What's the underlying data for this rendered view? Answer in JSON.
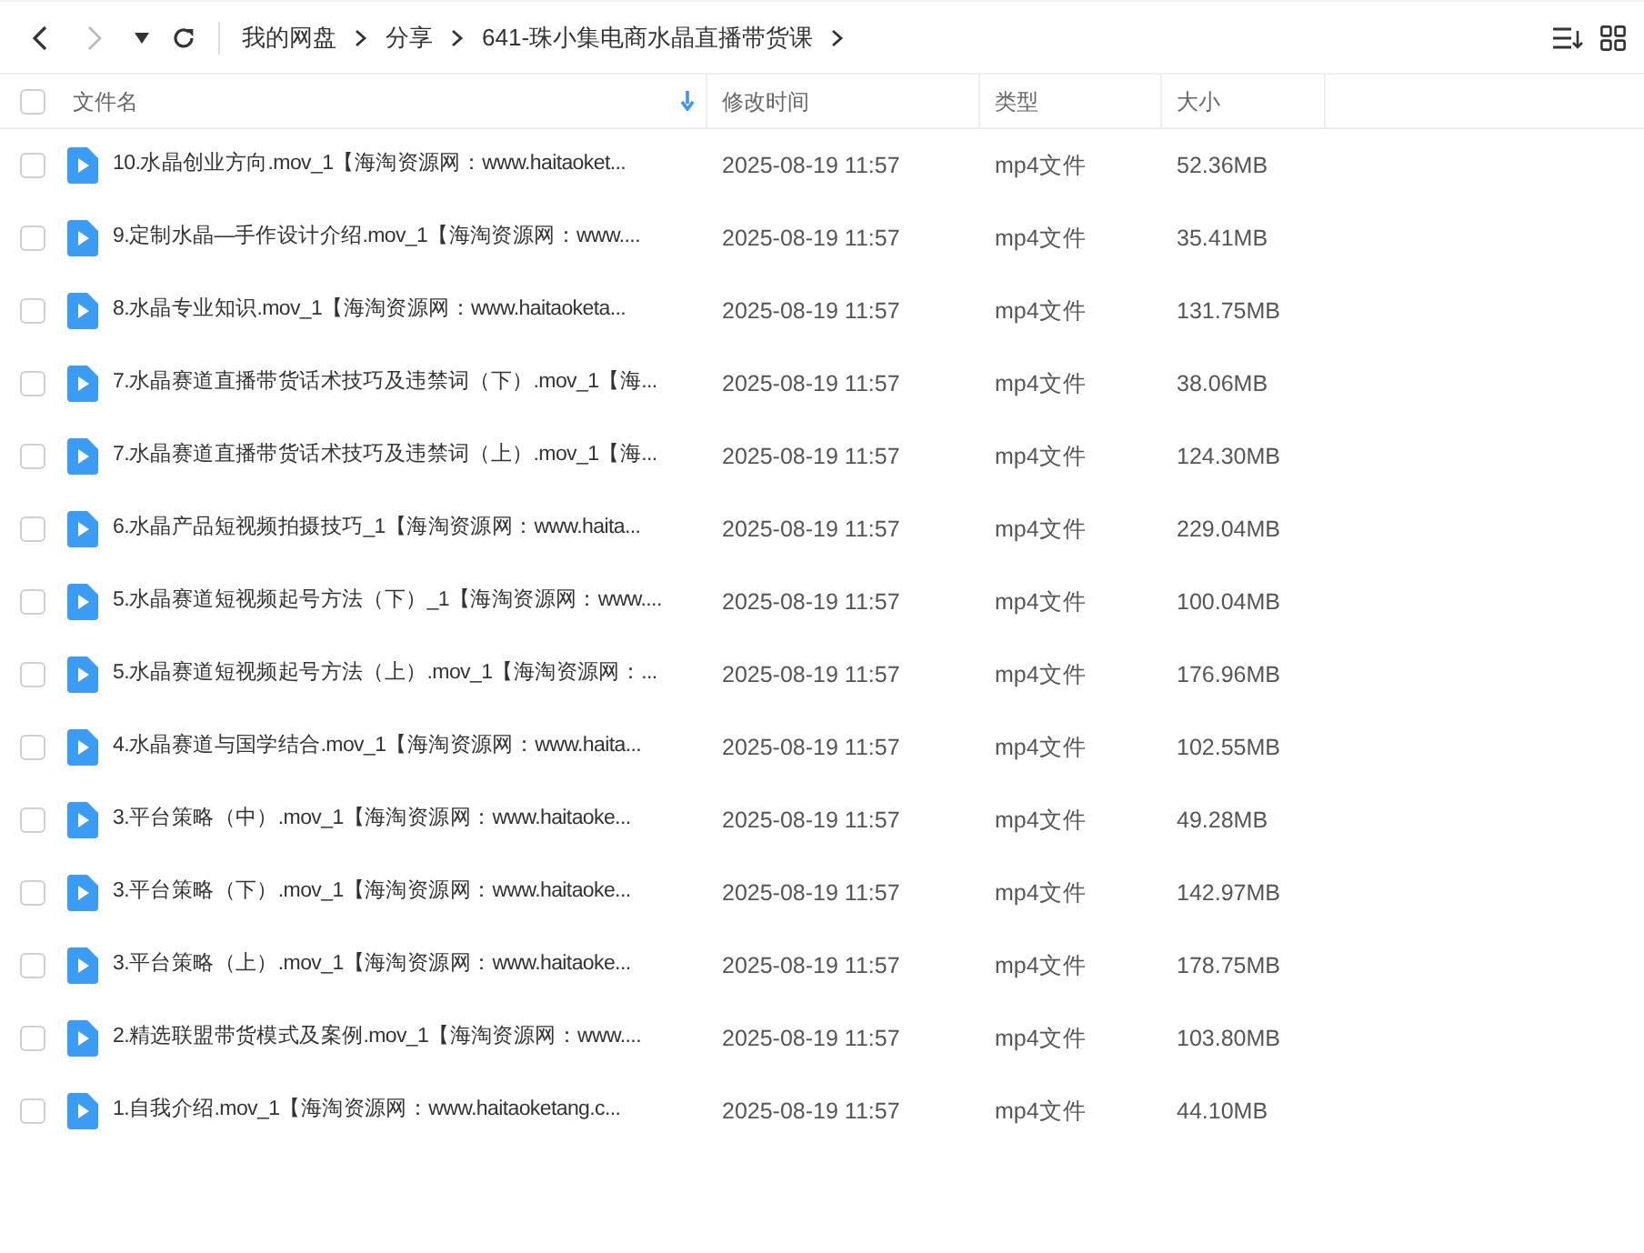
{
  "breadcrumb": [
    "我的网盘",
    "分享",
    "641-珠小集电商水晶直播带货课"
  ],
  "table": {
    "select_all": {
      "checked": false
    },
    "columns": [
      {
        "label": "文件名",
        "sorted": true
      },
      {
        "label": "修改时间",
        "sorted": false
      },
      {
        "label": "类型",
        "sorted": false
      },
      {
        "label": "大小",
        "sorted": false
      }
    ],
    "rows": [
      {
        "checked": false,
        "name": "10.水晶创业方向.mov_1【海淘资源网：www.haitaoket...",
        "modified": "2025-08-19 11:57",
        "type": "mp4文件",
        "size": "52.36MB"
      },
      {
        "checked": false,
        "name": "9.定制水晶—手作设计介绍.mov_1【海淘资源网：www....",
        "modified": "2025-08-19 11:57",
        "type": "mp4文件",
        "size": "35.41MB"
      },
      {
        "checked": false,
        "name": "8.水晶专业知识.mov_1【海淘资源网：www.haitaoketa...",
        "modified": "2025-08-19 11:57",
        "type": "mp4文件",
        "size": "131.75MB"
      },
      {
        "checked": false,
        "name": "7.水晶赛道直播带货话术技巧及违禁词（下）.mov_1【海...",
        "modified": "2025-08-19 11:57",
        "type": "mp4文件",
        "size": "38.06MB"
      },
      {
        "checked": false,
        "name": "7.水晶赛道直播带货话术技巧及违禁词（上）.mov_1【海...",
        "modified": "2025-08-19 11:57",
        "type": "mp4文件",
        "size": "124.30MB"
      },
      {
        "checked": false,
        "name": "6.水晶产品短视频拍摄技巧_1【海淘资源网：www.haita...",
        "modified": "2025-08-19 11:57",
        "type": "mp4文件",
        "size": "229.04MB"
      },
      {
        "checked": false,
        "name": "5.水晶赛道短视频起号方法（下）_1【海淘资源网：www....",
        "modified": "2025-08-19 11:57",
        "type": "mp4文件",
        "size": "100.04MB"
      },
      {
        "checked": false,
        "name": "5.水晶赛道短视频起号方法（上）.mov_1【海淘资源网：...",
        "modified": "2025-08-19 11:57",
        "type": "mp4文件",
        "size": "176.96MB"
      },
      {
        "checked": false,
        "name": "4.水晶赛道与国学结合.mov_1【海淘资源网：www.haita...",
        "modified": "2025-08-19 11:57",
        "type": "mp4文件",
        "size": "102.55MB"
      },
      {
        "checked": false,
        "name": "3.平台策略（中）.mov_1【海淘资源网：www.haitaoke...",
        "modified": "2025-08-19 11:57",
        "type": "mp4文件",
        "size": "49.28MB"
      },
      {
        "checked": false,
        "name": "3.平台策略（下）.mov_1【海淘资源网：www.haitaoke...",
        "modified": "2025-08-19 11:57",
        "type": "mp4文件",
        "size": "142.97MB"
      },
      {
        "checked": false,
        "name": "3.平台策略（上）.mov_1【海淘资源网：www.haitaoke...",
        "modified": "2025-08-19 11:57",
        "type": "mp4文件",
        "size": "178.75MB"
      },
      {
        "checked": false,
        "name": "2.精选联盟带货模式及案例.mov_1【海淘资源网：www....",
        "modified": "2025-08-19 11:57",
        "type": "mp4文件",
        "size": "103.80MB"
      },
      {
        "checked": false,
        "name": "1.自我介绍.mov_1【海淘资源网：www.haitaoketang.c...",
        "modified": "2025-08-19 11:57",
        "type": "mp4文件",
        "size": "44.10MB"
      }
    ]
  }
}
